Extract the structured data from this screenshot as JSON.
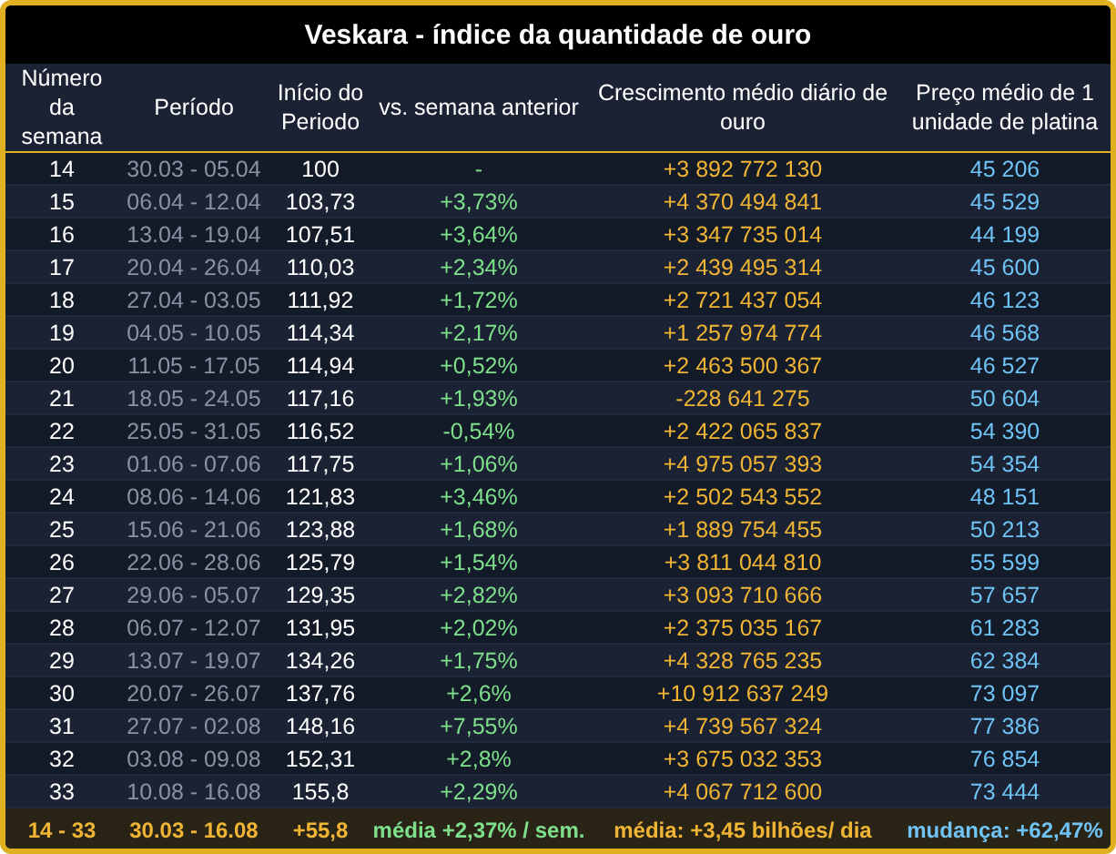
{
  "title": "Veskara - índice da quantidade de ouro",
  "columns": [
    "Número da semana",
    "Período",
    "Início do Periodo",
    "vs. semana anterior",
    "Crescimento médio diário de ouro",
    "Preço médio de 1 unidade de platina"
  ],
  "rows": [
    {
      "week": "14",
      "period": "30.03 - 05.04",
      "start": "100",
      "change": "-",
      "growth": "+3 892 772 130",
      "price": "45 206"
    },
    {
      "week": "15",
      "period": "06.04 - 12.04",
      "start": "103,73",
      "change": "+3,73%",
      "growth": "+4 370 494 841",
      "price": "45 529"
    },
    {
      "week": "16",
      "period": "13.04 - 19.04",
      "start": "107,51",
      "change": "+3,64%",
      "growth": "+3 347 735 014",
      "price": "44 199"
    },
    {
      "week": "17",
      "period": "20.04 - 26.04",
      "start": "110,03",
      "change": "+2,34%",
      "growth": "+2 439 495 314",
      "price": "45 600"
    },
    {
      "week": "18",
      "period": "27.04 - 03.05",
      "start": "111,92",
      "change": "+1,72%",
      "growth": "+2 721 437 054",
      "price": "46 123"
    },
    {
      "week": "19",
      "period": "04.05 - 10.05",
      "start": "114,34",
      "change": "+2,17%",
      "growth": "+1 257 974 774",
      "price": "46 568"
    },
    {
      "week": "20",
      "period": "11.05 - 17.05",
      "start": "114,94",
      "change": "+0,52%",
      "growth": "+2 463 500 367",
      "price": "46 527"
    },
    {
      "week": "21",
      "period": "18.05 - 24.05",
      "start": "117,16",
      "change": "+1,93%",
      "growth": "-228 641 275",
      "price": "50 604"
    },
    {
      "week": "22",
      "period": "25.05 - 31.05",
      "start": "116,52",
      "change": "-0,54%",
      "growth": "+2 422 065 837",
      "price": "54 390"
    },
    {
      "week": "23",
      "period": "01.06 - 07.06",
      "start": "117,75",
      "change": "+1,06%",
      "growth": "+4 975 057 393",
      "price": "54 354"
    },
    {
      "week": "24",
      "period": "08.06 - 14.06",
      "start": "121,83",
      "change": "+3,46%",
      "growth": "+2 502 543 552",
      "price": "48 151"
    },
    {
      "week": "25",
      "period": "15.06 - 21.06",
      "start": "123,88",
      "change": "+1,68%",
      "growth": "+1 889 754 455",
      "price": "50 213"
    },
    {
      "week": "26",
      "period": "22.06 - 28.06",
      "start": "125,79",
      "change": "+1,54%",
      "growth": "+3 811 044 810",
      "price": "55 599"
    },
    {
      "week": "27",
      "period": "29.06 - 05.07",
      "start": "129,35",
      "change": "+2,82%",
      "growth": "+3 093 710 666",
      "price": "57 657"
    },
    {
      "week": "28",
      "period": "06.07 - 12.07",
      "start": "131,95",
      "change": "+2,02%",
      "growth": "+2 375 035 167",
      "price": "61 283"
    },
    {
      "week": "29",
      "period": "13.07 - 19.07",
      "start": "134,26",
      "change": "+1,75%",
      "growth": "+4 328 765 235",
      "price": "62 384"
    },
    {
      "week": "30",
      "period": "20.07 - 26.07",
      "start": "137,76",
      "change": "+2,6%",
      "growth": "+10 912 637 249",
      "price": "73 097"
    },
    {
      "week": "31",
      "period": "27.07 - 02.08",
      "start": "148,16",
      "change": "+7,55%",
      "growth": "+4 739 567 324",
      "price": "77 386"
    },
    {
      "week": "32",
      "period": "03.08 - 09.08",
      "start": "152,31",
      "change": "+2,8%",
      "growth": "+3 675 032 353",
      "price": "76 854"
    },
    {
      "week": "33",
      "period": "10.08 - 16.08",
      "start": "155,8",
      "change": "+2,29%",
      "growth": "+4 067 712 600",
      "price": "73 444"
    }
  ],
  "summary": {
    "weeks": "14 - 33",
    "period": "30.03 - 16.08",
    "start": "+55,8",
    "change": "média +2,37% / sem.",
    "growth": "média: +3,45 bilhões/ dia",
    "price": "mudança: +62,47%"
  }
}
